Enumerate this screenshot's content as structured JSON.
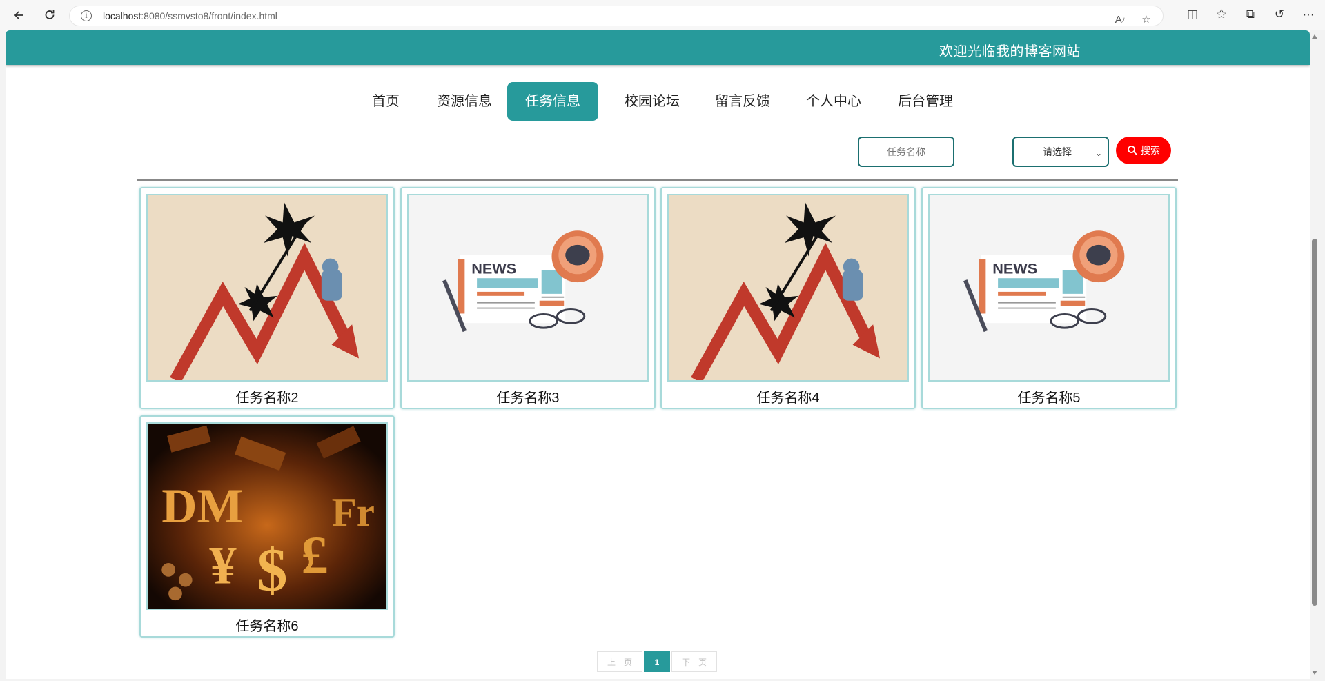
{
  "browser": {
    "url_host": "localhost",
    "url_rest": ":8080/ssmvsto8/front/index.html"
  },
  "site": {
    "title": "欢迎光临我的博客网站"
  },
  "menu": {
    "items": [
      {
        "label": "首页"
      },
      {
        "label": "资源信息"
      },
      {
        "label": "任务信息"
      },
      {
        "label": "校园论坛"
      },
      {
        "label": "留言反馈"
      },
      {
        "label": "个人中心"
      },
      {
        "label": "后台管理"
      }
    ],
    "active": "任务信息"
  },
  "search": {
    "placeholder": "任务名称",
    "select_value": "请选择",
    "button_label": "搜索"
  },
  "cards": [
    {
      "name": "任务名称2",
      "image": "falling-chart-illustration"
    },
    {
      "name": "任务名称3",
      "image": "news-illustration"
    },
    {
      "name": "任务名称4",
      "image": "falling-chart-illustration"
    },
    {
      "name": "任务名称5",
      "image": "news-illustration"
    },
    {
      "name": "任务名称6",
      "image": "currency-symbols-photo"
    }
  ],
  "news_text": "NEWS",
  "currency_text": {
    "dm": "DM",
    "yen": "¥",
    "dollar": "$",
    "pound": "£",
    "fr": "Fr"
  },
  "pagination": {
    "prev_label": "上一页",
    "current": "1",
    "next_label": "下一页"
  },
  "colors": {
    "primary": "#279a9b",
    "search_button": "#ff0000"
  }
}
